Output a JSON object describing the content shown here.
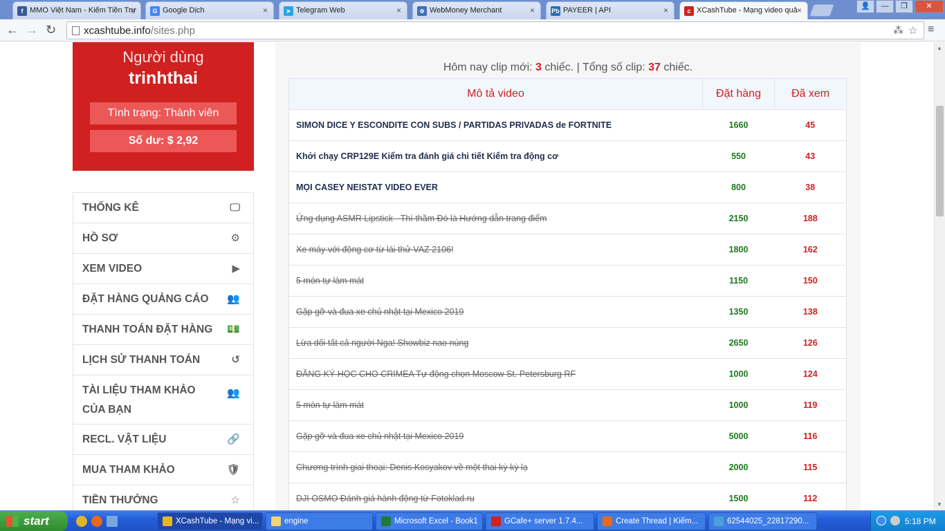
{
  "browser": {
    "tabs": [
      {
        "title": "MMO Việt Nam - Kiếm Tiền Trự",
        "icon": "facebook-icon",
        "color": "#3b5998",
        "glyph": "f"
      },
      {
        "title": "Google Dịch",
        "icon": "google-translate-icon",
        "color": "#4285f4",
        "glyph": "G"
      },
      {
        "title": "Telegram Web",
        "icon": "telegram-icon",
        "color": "#2ca5e0",
        "glyph": "➤"
      },
      {
        "title": "WebMoney Merchant",
        "icon": "webmoney-icon",
        "color": "#3f6fb5",
        "glyph": "⊕"
      },
      {
        "title": "PAYEER | API",
        "icon": "payeer-icon",
        "color": "#2a6db5",
        "glyph": "Pb"
      },
      {
        "title": "XCashTube - Mạng video quả",
        "icon": "xcashtube-icon",
        "color": "#d12020",
        "glyph": "c"
      }
    ],
    "url_domain": "xcashtube.info",
    "url_path": "/sites.php",
    "back_glyph": "←",
    "forward_glyph": "→",
    "reload_glyph": "↻",
    "star_glyph": "☆",
    "translate_glyph": "⁂",
    "menu_glyph": "≡",
    "close_glyph": "×",
    "win_min": "—",
    "win_restore": "❐",
    "win_close": "✕",
    "win_user": "👤"
  },
  "user": {
    "label": "Người dùng",
    "name": "trinhthai",
    "status_label": "Tình trạng:",
    "status_value": "Thành viên",
    "balance_label": "Số dư:",
    "balance_value": "$ 2,92"
  },
  "menu": [
    {
      "label": "THỐNG KÊ",
      "icon": "monitor-icon",
      "glyph": "🖵",
      "tall": false
    },
    {
      "label": "HỒ SƠ",
      "icon": "gear-icon",
      "glyph": "⚙",
      "tall": false
    },
    {
      "label": "XEM VIDEO",
      "icon": "play-circle-icon",
      "glyph": "▶",
      "tall": false
    },
    {
      "label": "ĐẶT HÀNG QUẢNG CÁO",
      "icon": "users-icon",
      "glyph": "👥",
      "tall": false
    },
    {
      "label": "THANH TOÁN ĐẶT HÀNG",
      "icon": "money-icon",
      "glyph": "💵",
      "tall": false
    },
    {
      "label": "LỊCH SỬ THANH TOÁN",
      "icon": "history-icon",
      "glyph": "↺",
      "tall": false
    },
    {
      "label": "TÀI LIỆU THAM KHẢO CỦA BẠN",
      "icon": "users-icon",
      "glyph": "👥",
      "tall": true
    },
    {
      "label": "RECL. VẬT LIỆU",
      "icon": "link-icon",
      "glyph": "🔗",
      "tall": false
    },
    {
      "label": "MUA THAM KHẢO",
      "icon": "shield-icon",
      "glyph": "🛡",
      "tall": false
    },
    {
      "label": "TIỀN THƯỞNG",
      "icon": "star-icon",
      "glyph": "☆",
      "tall": false
    }
  ],
  "stats": {
    "prefix": "Hôm nay clip mới:",
    "new_count": "3",
    "mid": "chiếc. | Tổng số clip:",
    "total_count": "37",
    "suffix": "chiếc."
  },
  "table": {
    "headers": [
      "Mô tả video",
      "Đặt hàng",
      "Đã xem"
    ],
    "rows": [
      {
        "desc": "SIMON DICE Y ESCONDITE CON SUBS / PARTIDAS PRIVADAS de FORTNITE",
        "order": "1660",
        "viewed": "45",
        "new": true
      },
      {
        "desc": "Khởi chạy CRP129E Kiểm tra đánh giá chi tiết Kiểm tra động cơ",
        "order": "550",
        "viewed": "43",
        "new": true
      },
      {
        "desc": "MỌI CASEY NEISTAT VIDEO EVER",
        "order": "800",
        "viewed": "38",
        "new": true
      },
      {
        "desc": "Ứng dụng ASMR Lipstick - Thì thầm Đó là Hướng dẫn trang điểm",
        "order": "2150",
        "viewed": "188",
        "new": false
      },
      {
        "desc": "Xe máy với động cơ từ lái thử VAZ 2106!",
        "order": "1800",
        "viewed": "162",
        "new": false
      },
      {
        "desc": "5 món tự làm mát",
        "order": "1150",
        "viewed": "150",
        "new": false
      },
      {
        "desc": "Gặp gỡ và đua xe chủ nhật tại Mexico 2019",
        "order": "1350",
        "viewed": "138",
        "new": false
      },
      {
        "desc": "Lừa dối tất cả người Nga! Showbiz nao núng",
        "order": "2650",
        "viewed": "126",
        "new": false
      },
      {
        "desc": "ĐĂNG KÝ HỌC CHO CRIMEA Tự động chọn Moscow St. Petersburg RF",
        "order": "1000",
        "viewed": "124",
        "new": false
      },
      {
        "desc": "5 món tự làm mát",
        "order": "1000",
        "viewed": "119",
        "new": false
      },
      {
        "desc": "Gặp gỡ và đua xe chủ nhật tại Mexico 2019",
        "order": "5000",
        "viewed": "116",
        "new": false
      },
      {
        "desc": "Chương trình giai thoại: Denis Kosyakov về một thai kỳ kỳ lạ",
        "order": "2000",
        "viewed": "115",
        "new": false
      },
      {
        "desc": "DJI OSMO Đánh giá hành động từ Fotoklad.ru",
        "order": "1500",
        "viewed": "112",
        "new": false
      }
    ]
  },
  "taskbar": {
    "start_label": "start",
    "tasks": [
      {
        "title": "XCashTube - Mạng vi...",
        "icon": "chrome-icon",
        "color": "#e8b32a",
        "active": true
      },
      {
        "title": "engine",
        "icon": "folder-icon",
        "color": "#f1d37a",
        "active": false
      },
      {
        "title": "Microsoft Excel - Book1",
        "icon": "excel-icon",
        "color": "#1f7a3a",
        "active": false
      },
      {
        "title": "GCafe+ server 1.7.4...",
        "icon": "gcafe-icon",
        "color": "#d12020",
        "active": false
      },
      {
        "title": "Create Thread | Kiếm...",
        "icon": "firefox-icon",
        "color": "#e66a1c",
        "active": false
      },
      {
        "title": "62544025_22817290...",
        "icon": "image-viewer-icon",
        "color": "#4aa0d8",
        "active": false
      }
    ],
    "clock": "5:18 PM"
  }
}
